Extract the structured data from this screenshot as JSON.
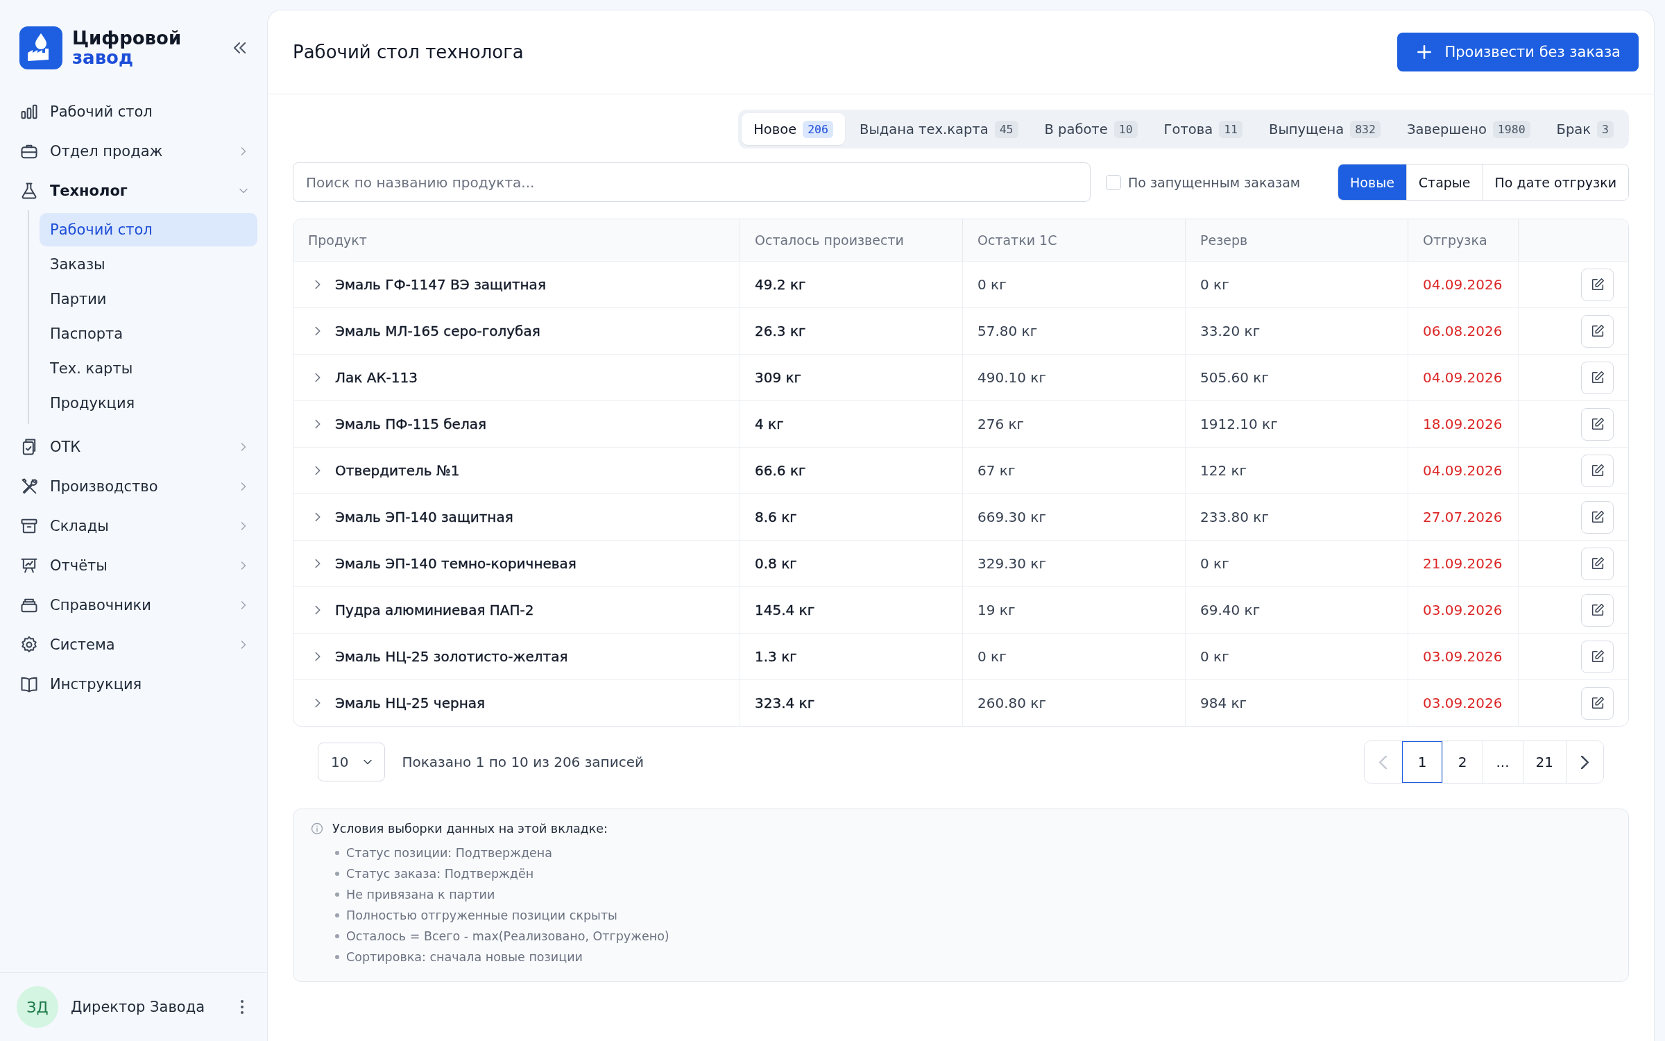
{
  "sidebar": {
    "logo": {
      "line1": "Цифровой",
      "line2": "завод"
    },
    "nav": [
      {
        "kind": "link",
        "label": "Рабочий стол"
      },
      {
        "kind": "group",
        "label": "Отдел продаж",
        "expanded": false
      },
      {
        "kind": "group",
        "label": "Технолог",
        "expanded": true,
        "children": [
          {
            "label": "Рабочий стол",
            "selected": true
          },
          {
            "label": "Заказы",
            "selected": false
          },
          {
            "label": "Партии",
            "selected": false
          },
          {
            "label": "Паспорта",
            "selected": false
          },
          {
            "label": "Тех. карты",
            "selected": false
          },
          {
            "label": "Продукция",
            "selected": false
          }
        ]
      },
      {
        "kind": "group",
        "label": "ОТК",
        "expanded": false
      },
      {
        "kind": "group",
        "label": "Производство",
        "expanded": false
      },
      {
        "kind": "group",
        "label": "Склады",
        "expanded": false
      },
      {
        "kind": "group",
        "label": "Отчёты",
        "expanded": false
      },
      {
        "kind": "group",
        "label": "Справочники",
        "expanded": false
      },
      {
        "kind": "group",
        "label": "Система",
        "expanded": false
      },
      {
        "kind": "link",
        "label": "Инструкция"
      }
    ],
    "user": {
      "initials": "ЗД",
      "name": "Директор Завода"
    }
  },
  "header": {
    "title": "Рабочий стол технолога",
    "action": "Произвести без заказа"
  },
  "tabs": [
    {
      "label": "Новое",
      "count": "206",
      "selected": true
    },
    {
      "label": "Выдана тех.карта",
      "count": "45",
      "selected": false
    },
    {
      "label": "В работе",
      "count": "10",
      "selected": false
    },
    {
      "label": "Готова",
      "count": "11",
      "selected": false
    },
    {
      "label": "Выпущена",
      "count": "832",
      "selected": false
    },
    {
      "label": "Завершено",
      "count": "1980",
      "selected": false
    },
    {
      "label": "Брак",
      "count": "3",
      "selected": false
    }
  ],
  "toolbar": {
    "search": {
      "placeholder": "Поиск по названию продукта..."
    },
    "filter": {
      "label": "По запущенным заказам",
      "checked": false
    },
    "sort": [
      {
        "label": "Новые",
        "selected": true
      },
      {
        "label": "Старые",
        "selected": false
      },
      {
        "label": "По дате отгрузки",
        "selected": false
      }
    ]
  },
  "table": {
    "columns": [
      "Продукт",
      "Осталось произвести",
      "Остатки 1С",
      "Резерв",
      "Отгрузка"
    ],
    "rows": [
      {
        "expanded": false,
        "product": "Эмаль ГФ-1147 ВЭ защитная",
        "remaining": "49.2 кг",
        "stock": "0 кг",
        "reserve": "0 кг",
        "shipment": "04.09.2026"
      },
      {
        "expanded": false,
        "product": "Эмаль МЛ-165 серо-голубая",
        "remaining": "26.3 кг",
        "stock": "57.80 кг",
        "reserve": "33.20 кг",
        "shipment": "06.08.2026"
      },
      {
        "expanded": false,
        "product": "Лак АК-113",
        "remaining": "309 кг",
        "stock": "490.10 кг",
        "reserve": "505.60 кг",
        "shipment": "04.09.2026"
      },
      {
        "expanded": false,
        "product": "Эмаль ПФ-115 белая",
        "remaining": "4 кг",
        "stock": "276 кг",
        "reserve": "1912.10 кг",
        "shipment": "18.09.2026"
      },
      {
        "expanded": false,
        "product": "Отвердитель №1",
        "remaining": "66.6 кг",
        "stock": "67 кг",
        "reserve": "122 кг",
        "shipment": "04.09.2026"
      },
      {
        "expanded": false,
        "product": "Эмаль ЭП-140 защитная",
        "remaining": "8.6 кг",
        "stock": "669.30 кг",
        "reserve": "233.80 кг",
        "shipment": "27.07.2026"
      },
      {
        "expanded": false,
        "product": "Эмаль ЭП-140 темно-коричневая",
        "remaining": "0.8 кг",
        "stock": "329.30 кг",
        "reserve": "0 кг",
        "shipment": "21.09.2026"
      },
      {
        "expanded": false,
        "product": "Пудра алюминиевая ПАП-2",
        "remaining": "145.4 кг",
        "stock": "19 кг",
        "reserve": "69.40 кг",
        "shipment": "03.09.2026"
      },
      {
        "expanded": false,
        "product": "Эмаль НЦ-25 золотисто-желтая",
        "remaining": "1.3 кг",
        "stock": "0 кг",
        "reserve": "0 кг",
        "shipment": "03.09.2026"
      },
      {
        "expanded": false,
        "product": "Эмаль НЦ-25 черная",
        "remaining": "323.4 кг",
        "stock": "260.80 кг",
        "reserve": "984 кг",
        "shipment": "03.09.2026"
      }
    ]
  },
  "pager": {
    "page_size": "10",
    "summary": "Показано 1 по 10 из 206 записей",
    "prev": {
      "disabled": true
    },
    "next": {
      "disabled": false
    },
    "pages": [
      {
        "label": "1",
        "selected": true
      },
      {
        "label": "2",
        "selected": false
      },
      {
        "label": "...",
        "selected": false
      },
      {
        "label": "21",
        "selected": false
      }
    ]
  },
  "info": {
    "title": "Условия выборки данных на этой вкладке:",
    "items": [
      "Статус позиции: Подтверждена",
      "Статус заказа: Подтверждён",
      "Не привязана к партии",
      "Полностью отгруженные позиции скрыты",
      "Осталось = Всего - max(Реализовано, Отгружено)",
      "Сортировка: сначала новые позиции"
    ]
  }
}
